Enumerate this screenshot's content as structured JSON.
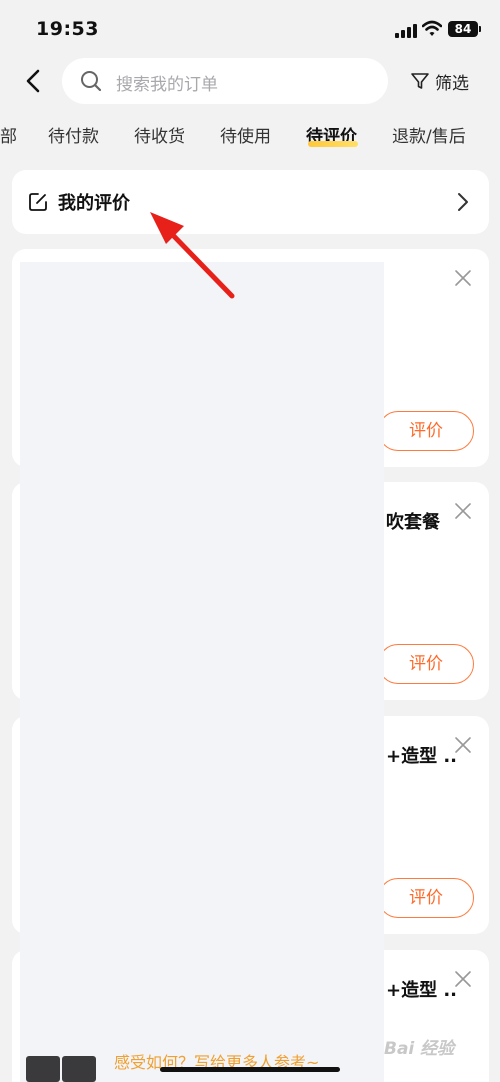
{
  "status_bar": {
    "time": "19:53",
    "battery": "84"
  },
  "header": {
    "search_placeholder": "搜索我的订单",
    "filter_label": "筛选"
  },
  "tabs": [
    {
      "label": "部"
    },
    {
      "label": "待付款"
    },
    {
      "label": "待收货"
    },
    {
      "label": "待使用"
    },
    {
      "label": "待评价",
      "active": true
    },
    {
      "label": "退款/售后"
    }
  ],
  "my_review": {
    "label": "我的评价"
  },
  "orders": [
    {
      "title": "",
      "button": "评价"
    },
    {
      "title": "吹套餐",
      "button": "评价"
    },
    {
      "title": "+造型 ..",
      "button": "评价"
    },
    {
      "title": "+造型 .."
    }
  ],
  "footer": {
    "promo": "感受如何？写给更多人参考~",
    "watermark": "Bai 经验"
  },
  "colors": {
    "accent": "#ff6a2a",
    "tab_underline": "#ffc83a",
    "annotation_arrow": "#e8201a"
  }
}
